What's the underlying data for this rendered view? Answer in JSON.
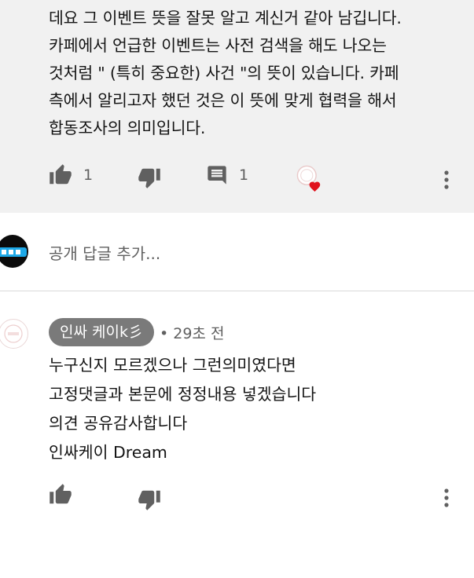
{
  "top_comment": {
    "text": "데요 그 이벤트 뜻을 잘못 알고 계신거 같아 남깁니다.\n카페에서 언급한 이벤트는 사전 검색을 해도 나오는\n것처럼 \" (특히 중요한) 사건 \"의 뜻이 있습니다.  카페\n측에서 알리고자 했던 것은 이 뜻에 맞게 협력을 해서\n합동조사의 의미입니다.",
    "like_count": "1",
    "reply_count": "1",
    "icons": [
      "thumbs-up-icon",
      "thumbs-down-icon",
      "comment-icon",
      "creator-heart-icon",
      "more-vert-icon"
    ],
    "heart_color": "#e0121d"
  },
  "reply_input": {
    "placeholder": "공개 답글 추가..."
  },
  "reply": {
    "author": "인싸 케이k彡",
    "time": "• 29초 전",
    "text": "누구신지 모르겠으나 그런의미였다면\n고정댓글과 본문에 정정내용 넣겠습니다\n의견 공유감사합니다\n인싸케이 Dream",
    "icons": [
      "thumbs-up-icon",
      "thumbs-down-icon",
      "more-vert-icon"
    ]
  },
  "colors": {
    "comment_bg": "#f1f1f1",
    "icon": "#606060",
    "chip_bg": "#7a7a7a"
  }
}
